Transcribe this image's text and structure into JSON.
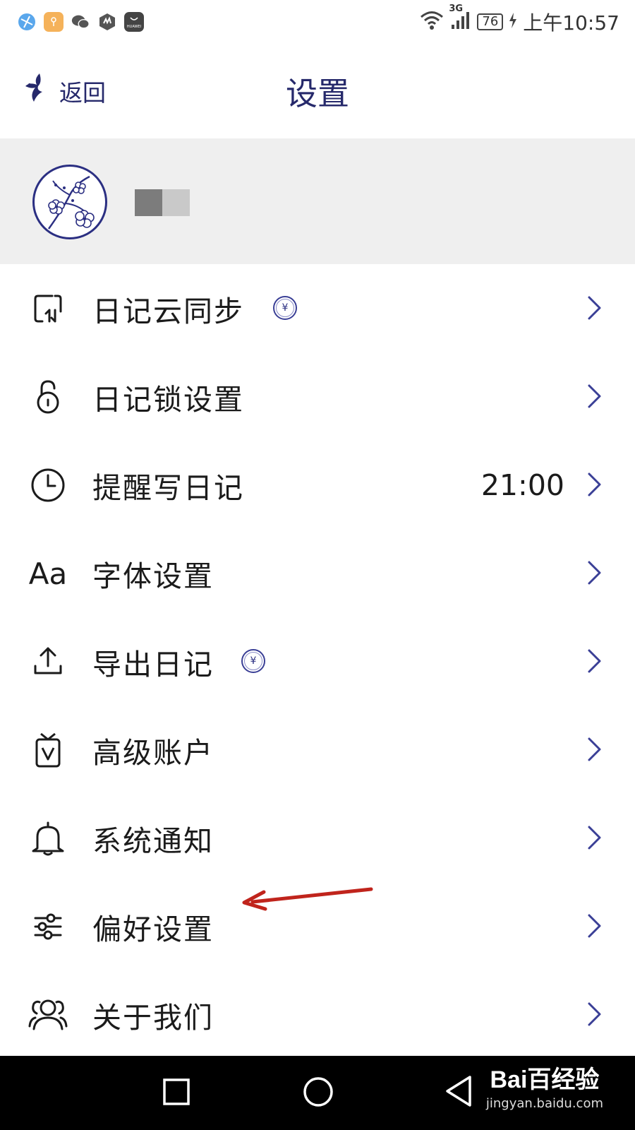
{
  "status_bar": {
    "network": "3G",
    "battery": "76",
    "time": "上午10:57",
    "app_icons": [
      "browser-icon",
      "notes-app-icon",
      "wechat-icon",
      "security-icon",
      "huawei-store-icon"
    ],
    "store_label": "HUAWEI"
  },
  "header": {
    "back_label": "返回",
    "title": "设置"
  },
  "profile": {
    "avatar_icon": "plum-blossom-avatar"
  },
  "menu": {
    "items": [
      {
        "label": "日记云同步",
        "icon": "cloud-sync-icon",
        "premium": true
      },
      {
        "label": "日记锁设置",
        "icon": "lock-icon"
      },
      {
        "label": "提醒写日记",
        "icon": "clock-icon",
        "value": "21:00"
      },
      {
        "label": "字体设置",
        "icon": "font-icon",
        "icon_text": "Aa"
      },
      {
        "label": "导出日记",
        "icon": "export-icon",
        "premium": true
      },
      {
        "label": "高级账户",
        "icon": "vip-badge-icon"
      },
      {
        "label": "系统通知",
        "icon": "bell-icon"
      },
      {
        "label": "偏好设置",
        "icon": "sliders-icon"
      },
      {
        "label": "关于我们",
        "icon": "users-icon"
      }
    ],
    "premium_symbol": "¥"
  },
  "colors": {
    "accent": "#26296b",
    "chevron": "#3a3f96",
    "annotation": "#c0241c",
    "profile_bg": "#efefef"
  },
  "watermark": {
    "main": "Bai百经验",
    "sub": "jingyan.baidu.com"
  }
}
